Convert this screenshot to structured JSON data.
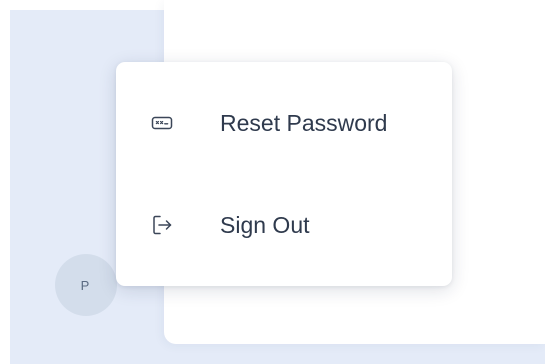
{
  "user": {
    "avatar_initial": "P"
  },
  "menu": {
    "items": [
      {
        "label": "Reset Password",
        "icon": "password-field-icon"
      },
      {
        "label": "Sign Out",
        "icon": "sign-out-icon"
      }
    ]
  },
  "colors": {
    "sidebar_bg": "#e4ebf8",
    "avatar_bg": "#d3ddeb",
    "menu_text": "#2f3a4d",
    "icon_stroke": "#3b4658"
  }
}
